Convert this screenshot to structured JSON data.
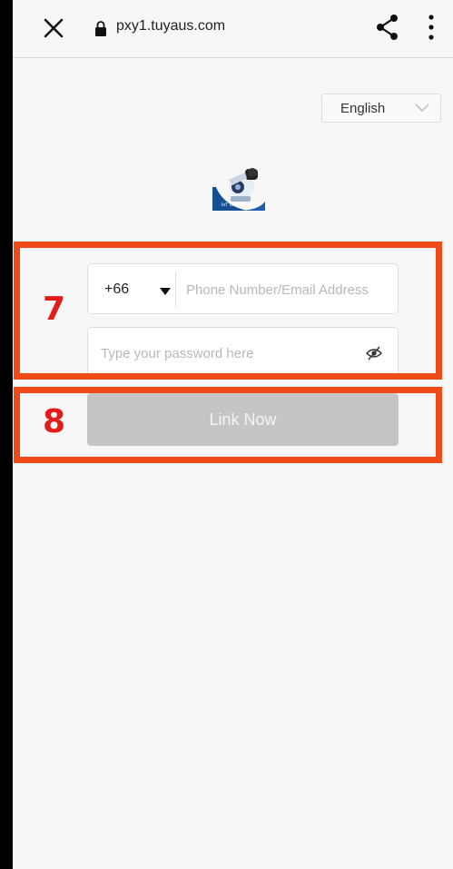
{
  "browser": {
    "url": "pxy1.tuyaus.com",
    "icons": {
      "close": "close-icon",
      "lock": "lock-icon",
      "share": "share-icon",
      "menu": "more-vert-icon"
    }
  },
  "language": {
    "selected": "English",
    "icon": "chevron-down-icon"
  },
  "logo": {
    "caption": "IoT Smart Home"
  },
  "annotations": {
    "box_a": "7",
    "box_b": "8",
    "color": "#f04a16",
    "number_color": "#e21b1b"
  },
  "form": {
    "country_code": "+66",
    "phone_placeholder": "Phone Number/Email Address",
    "phone_value": "",
    "password_placeholder": "Type your password here",
    "password_value": "",
    "password_toggle_icon": "eye-off-icon"
  },
  "submit": {
    "label": "Link Now",
    "color": "#c5c5c5"
  }
}
